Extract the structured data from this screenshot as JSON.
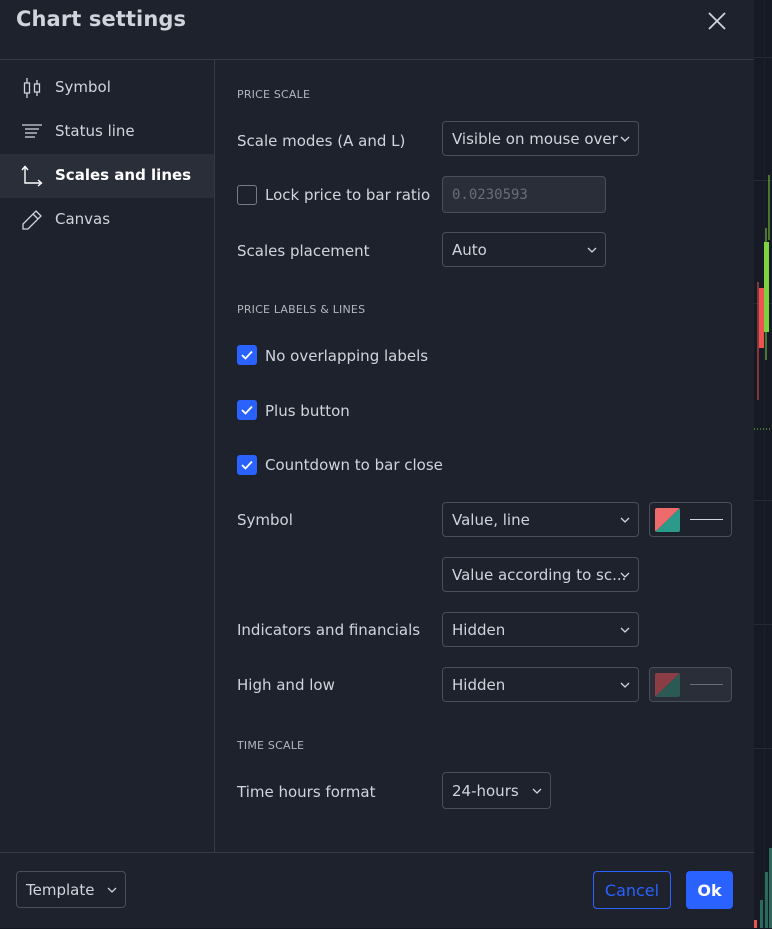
{
  "dialog": {
    "title": "Chart settings"
  },
  "sidebar": {
    "items": [
      {
        "label": "Symbol",
        "icon": "candlestick-icon"
      },
      {
        "label": "Status line",
        "icon": "status-line-icon"
      },
      {
        "label": "Scales and lines",
        "icon": "axes-icon",
        "active": true
      },
      {
        "label": "Canvas",
        "icon": "pencil-icon"
      }
    ]
  },
  "price_scale": {
    "section_title": "PRICE SCALE",
    "scale_modes_label": "Scale modes (A and L)",
    "scale_modes_value": "Visible on mouse over",
    "lock_ratio_label": "Lock price to bar ratio",
    "lock_ratio_checked": false,
    "lock_ratio_value": "0.0230593",
    "placement_label": "Scales placement",
    "placement_value": "Auto"
  },
  "price_labels": {
    "section_title": "PRICE LABELS & LINES",
    "no_overlap_label": "No overlapping labels",
    "no_overlap_checked": true,
    "plus_button_label": "Plus button",
    "plus_button_checked": true,
    "countdown_label": "Countdown to bar close",
    "countdown_checked": true,
    "symbol_label": "Symbol",
    "symbol_value": "Value, line",
    "symbol_value2": "Value according to sc...",
    "indicators_label": "Indicators and financials",
    "indicators_value": "Hidden",
    "highlow_label": "High and low",
    "highlow_value": "Hidden"
  },
  "time_scale": {
    "section_title": "TIME SCALE",
    "hours_format_label": "Time hours format",
    "hours_format_value": "24-hours"
  },
  "footer": {
    "template_label": "Template",
    "cancel_label": "Cancel",
    "ok_label": "Ok"
  },
  "colors": {
    "accent": "#2962ff",
    "bull": "#26a69a",
    "bear": "#ef5350",
    "panel": "#1e222d"
  }
}
